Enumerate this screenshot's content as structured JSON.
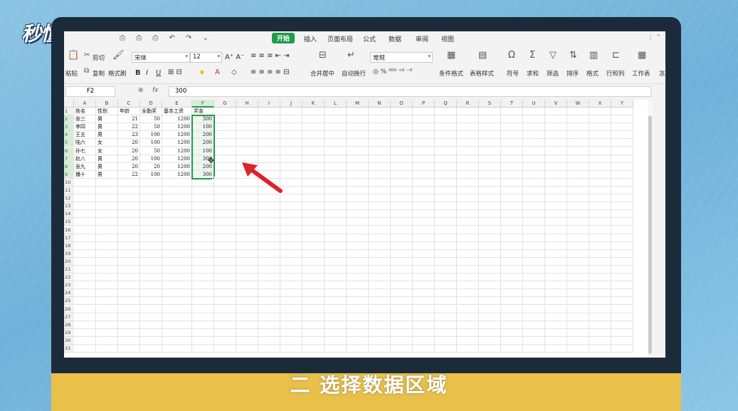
{
  "logo_text": "秒懂视频",
  "caption": "二 选择数据区域",
  "quick_access": "⎙ ⎙ ⎙ ↶ ↷ ⌄",
  "menu": [
    "开始",
    "插入",
    "页面布局",
    "公式",
    "数据",
    "审阅",
    "视图"
  ],
  "ribbon": {
    "cut": "剪切",
    "copy": "复制",
    "paste": "粘贴",
    "format_painter": "格式刷",
    "font": "宋体",
    "font_size": "12",
    "merge_center": "合并居中",
    "wrap_text": "自动换行",
    "number_format": "常规",
    "cond_format": "条件格式",
    "table_style": "表格样式",
    "symbol": "符号",
    "sum": "求和",
    "filter": "筛选",
    "sort": "排序",
    "format": "格式",
    "row_col": "行和列",
    "worksheet": "工作表",
    "freeze": "冻"
  },
  "name_box": "F2",
  "fx_label": "fx",
  "formula_value": "300",
  "columns": [
    "A",
    "B",
    "C",
    "D",
    "E",
    "F",
    "G",
    "H",
    "I",
    "J",
    "K",
    "L",
    "M",
    "N",
    "O",
    "P",
    "Q",
    "R",
    "S",
    "T",
    "U",
    "V",
    "W",
    "X",
    "Y"
  ],
  "row_count": 31,
  "table": {
    "headers": [
      "姓名",
      "性别",
      "年龄",
      "全勤奖",
      "基本工资",
      "奖金"
    ],
    "rows": [
      [
        "张三",
        "男",
        "21",
        "50",
        "1200",
        "300"
      ],
      [
        "李四",
        "男",
        "22",
        "50",
        "1200",
        "100"
      ],
      [
        "王五",
        "男",
        "23",
        "100",
        "1200",
        "200"
      ],
      [
        "陆六",
        "女",
        "20",
        "100",
        "1200",
        "200"
      ],
      [
        "孙七",
        "女",
        "20",
        "50",
        "1200",
        "100"
      ],
      [
        "赵八",
        "男",
        "20",
        "100",
        "1200",
        "300"
      ],
      [
        "张九",
        "男",
        "20",
        "20",
        "1200",
        "200"
      ],
      [
        "播十",
        "男",
        "22",
        "100",
        "1200",
        "300"
      ]
    ]
  },
  "colors": {
    "accent": "#1e9d48",
    "caption_bg": "#e8c04a",
    "arrow": "#d9252b"
  }
}
